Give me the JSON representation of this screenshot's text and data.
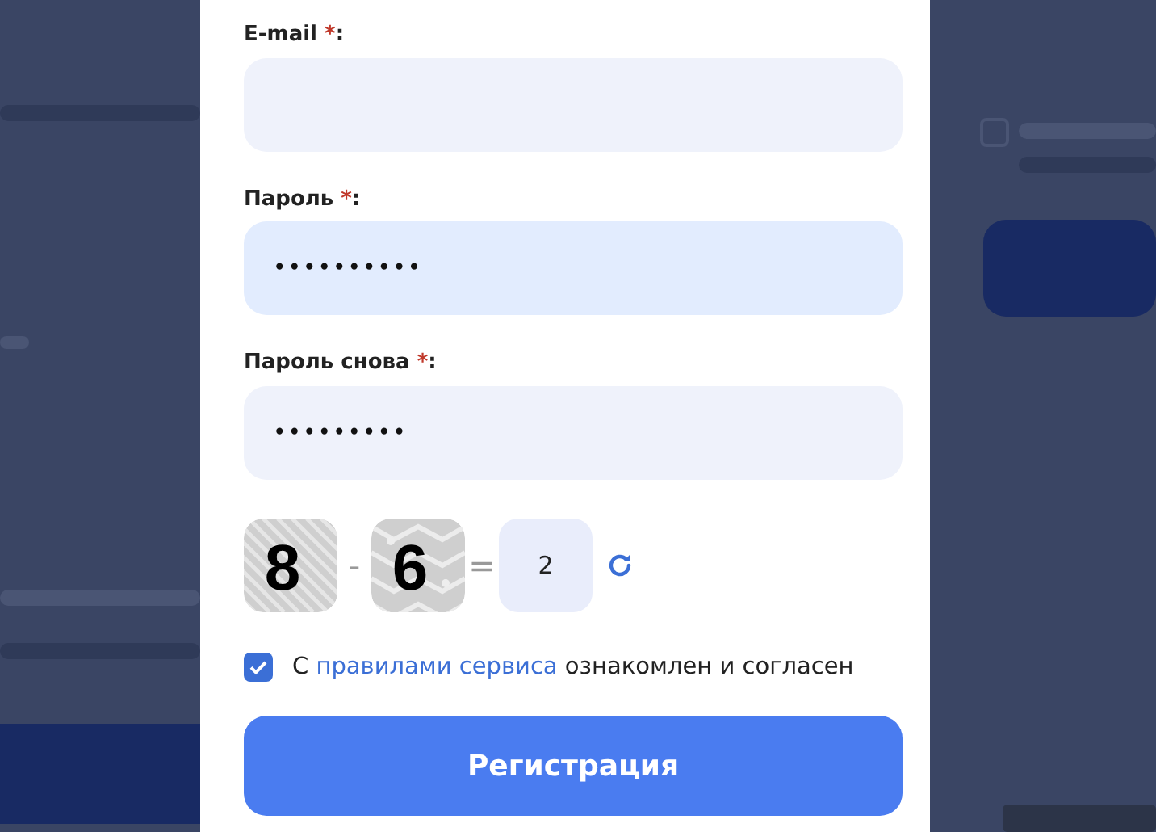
{
  "form": {
    "fields": [
      {
        "label": "E-mail",
        "required_mark": "*",
        "suffix": ":",
        "autofilled": false
      },
      {
        "label": "Пароль",
        "required_mark": "*",
        "suffix": ":",
        "value": "••••••••••",
        "autofilled": true
      },
      {
        "label": "Пароль снова",
        "required_mark": "*",
        "suffix": ":",
        "value": "•••••••••",
        "autofilled": false
      }
    ],
    "captcha": {
      "operand_1": "8",
      "operator": "-",
      "operand_2": "6",
      "equals": "=",
      "answer": "2"
    },
    "agreement": {
      "checked": true,
      "text_before": "С",
      "link": "правилами сервиса",
      "text_after": "ознакомлен и согласен"
    },
    "submit": "Регистрация"
  }
}
